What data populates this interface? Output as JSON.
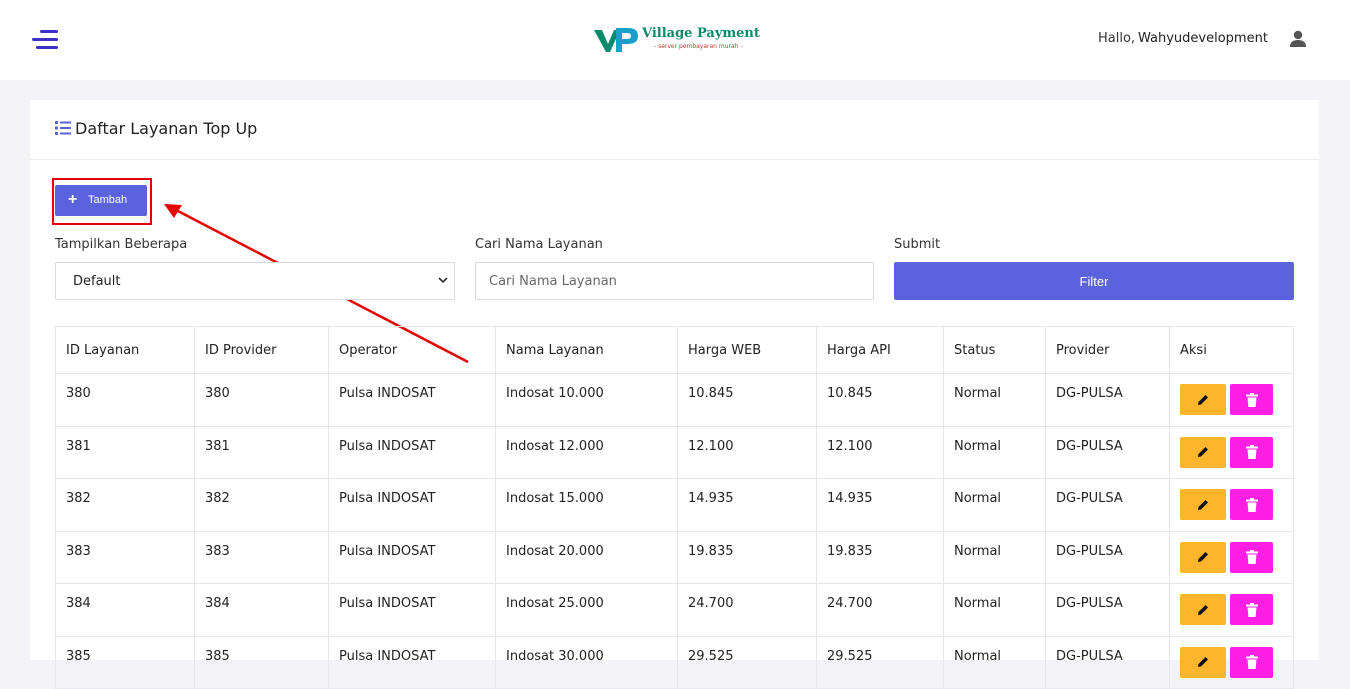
{
  "header": {
    "logo_text": "Village Payment",
    "logo_sub": "- server pembayaran murah -",
    "hello": "Hallo,",
    "username": "Wahyudevelopment"
  },
  "card": {
    "title": "Daftar Layanan Top Up",
    "add_button": "Tambah"
  },
  "filters": {
    "show_label": "Tampilkan Beberapa",
    "show_value": "Default",
    "search_label": "Cari Nama Layanan",
    "search_placeholder": "Cari Nama Layanan",
    "submit_label": "Submit",
    "filter_button": "Filter"
  },
  "table": {
    "headers": [
      "ID Layanan",
      "ID Provider",
      "Operator",
      "Nama Layanan",
      "Harga WEB",
      "Harga API",
      "Status",
      "Provider",
      "Aksi"
    ],
    "rows": [
      [
        "380",
        "380",
        "Pulsa INDOSAT",
        "Indosat 10.000",
        "10.845",
        "10.845",
        "Normal",
        "DG-PULSA"
      ],
      [
        "381",
        "381",
        "Pulsa INDOSAT",
        "Indosat 12.000",
        "12.100",
        "12.100",
        "Normal",
        "DG-PULSA"
      ],
      [
        "382",
        "382",
        "Pulsa INDOSAT",
        "Indosat 15.000",
        "14.935",
        "14.935",
        "Normal",
        "DG-PULSA"
      ],
      [
        "383",
        "383",
        "Pulsa INDOSAT",
        "Indosat 20.000",
        "19.835",
        "19.835",
        "Normal",
        "DG-PULSA"
      ],
      [
        "384",
        "384",
        "Pulsa INDOSAT",
        "Indosat 25.000",
        "24.700",
        "24.700",
        "Normal",
        "DG-PULSA"
      ],
      [
        "385",
        "385",
        "Pulsa INDOSAT",
        "Indosat 30.000",
        "29.525",
        "29.525",
        "Normal",
        "DG-PULSA"
      ]
    ]
  },
  "colors": {
    "primary": "#5a62dd",
    "edit": "#fdb52c",
    "delete": "#ff1ee3",
    "annotation": "#e30000"
  }
}
